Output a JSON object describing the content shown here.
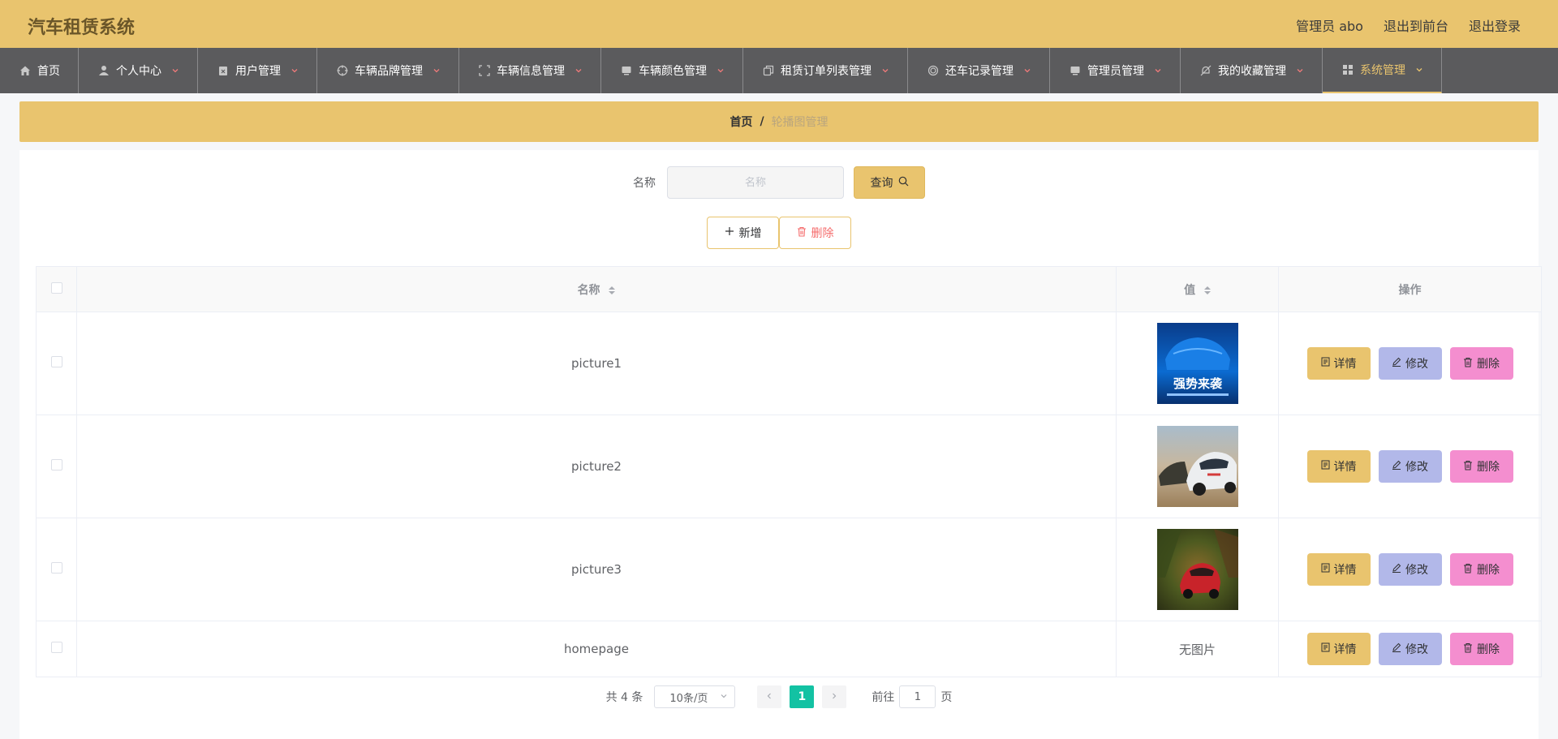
{
  "app": {
    "title": "汽车租赁系统"
  },
  "header": {
    "user_label": "管理员 abo",
    "front_label": "退出到前台",
    "logout_label": "退出登录"
  },
  "nav": {
    "items": [
      {
        "label": "首页",
        "icon": "home-icon"
      },
      {
        "label": "个人中心",
        "icon": "user-icon"
      },
      {
        "label": "用户管理",
        "icon": "clipboard-icon"
      },
      {
        "label": "车辆品牌管理",
        "icon": "target-icon"
      },
      {
        "label": "车辆信息管理",
        "icon": "fullscreen-icon"
      },
      {
        "label": "车辆颜色管理",
        "icon": "monitor-icon"
      },
      {
        "label": "租赁订单列表管理",
        "icon": "copy-icon"
      },
      {
        "label": "还车记录管理",
        "icon": "ring-icon"
      },
      {
        "label": "管理员管理",
        "icon": "monitor-icon"
      },
      {
        "label": "我的收藏管理",
        "icon": "bell-off-icon"
      },
      {
        "label": "系统管理",
        "icon": "grid-icon"
      }
    ],
    "active_index": 10,
    "active_color": "#e9c46e"
  },
  "breadcrumb": {
    "home": "首页",
    "separator": "/",
    "current": "轮播图管理"
  },
  "search": {
    "label": "名称",
    "placeholder": "名称",
    "value": "",
    "button_label": "查询"
  },
  "actions": {
    "add_label": "新增",
    "delete_label": "删除"
  },
  "table": {
    "headers": {
      "name": "名称",
      "value": "值",
      "ops": "操作"
    },
    "rows": [
      {
        "name": "picture1",
        "value": "image",
        "image_desc": "blue-car-poster"
      },
      {
        "name": "picture2",
        "value": "image",
        "image_desc": "white-race-car"
      },
      {
        "name": "picture3",
        "value": "image",
        "image_desc": "red-car-blur"
      },
      {
        "name": "homepage",
        "value": "无图片",
        "image_desc": ""
      }
    ],
    "row_buttons": {
      "detail": "详情",
      "edit": "修改",
      "delete": "删除"
    },
    "poster_text": "强势来袭"
  },
  "pagination": {
    "total": "共 4 条",
    "page_size": "10条/页",
    "current_page": "1",
    "goto_prefix": "前往",
    "goto_value": "1",
    "goto_suffix": "页"
  }
}
